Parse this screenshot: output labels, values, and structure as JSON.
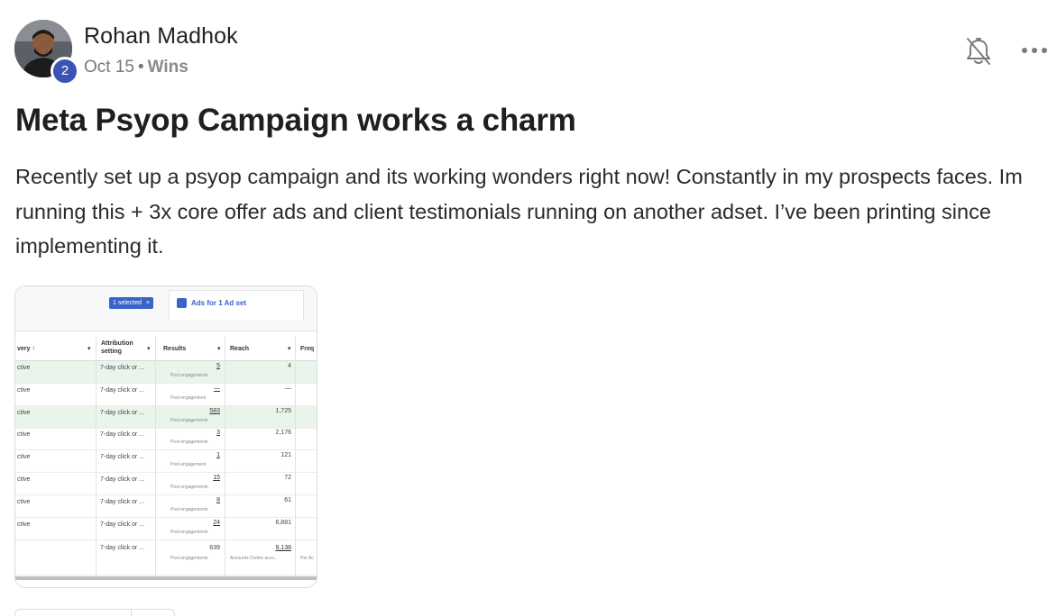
{
  "post": {
    "author": "Rohan Madhok",
    "level": "2",
    "date": "Oct 15",
    "separator": "•",
    "category": "Wins",
    "title": "Meta Psyop Campaign works a charm",
    "body": "Recently set up a psyop campaign and its working wonders right now! Constantly in my prospects faces. Im running this + 3x core offer ads and client testimonials running on another adset. I’ve been printing since implementing it."
  },
  "icons": {
    "bell": "bell-muted-icon",
    "more": "more-horizontal-icon"
  },
  "colors": {
    "badge": "#3b53b5",
    "highlight_row": "#e9f4ea",
    "fb_blue": "#3a63c8"
  },
  "attachment": {
    "selected_chip": "1 selected",
    "chip_close": "×",
    "ads_tab": "Ads for 1 Ad set",
    "headers": {
      "delivery": "very ↑",
      "attribution": "Attribution setting",
      "results": "Results",
      "reach": "Reach",
      "freq": "Freq"
    },
    "rows": [
      {
        "delivery": "ctive",
        "attr": "7-day click or ...",
        "result": "5",
        "result_sub": "Post engagements",
        "reach": "4",
        "highlight": true
      },
      {
        "delivery": "ctive",
        "attr": "7-day click or ...",
        "result": "—",
        "result_sub": "Post engagement",
        "reach": "—",
        "highlight": false
      },
      {
        "delivery": "ctive",
        "attr": "7-day click or ...",
        "result": "583",
        "result_sub": "Post engagements",
        "reach": "1,725",
        "highlight": true
      },
      {
        "delivery": "ctive",
        "attr": "7-day click or ...",
        "result": "3",
        "result_sub": "Post engagements",
        "reach": "2,176",
        "highlight": false
      },
      {
        "delivery": "ctive",
        "attr": "7-day click or ...",
        "result": "1",
        "result_sub": "Post engagement",
        "reach": "121",
        "highlight": false
      },
      {
        "delivery": "ctive",
        "attr": "7-day click or ...",
        "result": "15",
        "result_sub": "Post engagements",
        "reach": "72",
        "highlight": false
      },
      {
        "delivery": "ctive",
        "attr": "7-day click or ...",
        "result": "8",
        "result_sub": "Post engagements",
        "reach": "61",
        "highlight": false
      },
      {
        "delivery": "ctive",
        "attr": "7-day click or ...",
        "result": "24",
        "result_sub": "Post engagements",
        "reach": "6,881",
        "highlight": false
      }
    ],
    "total": {
      "attr": "7-day click or ...",
      "result": "639",
      "result_sub": "Post engagements",
      "reach": "9,138",
      "reach_sub": "Accounts Centre acco...",
      "freq_sub": "Per Ac"
    }
  }
}
